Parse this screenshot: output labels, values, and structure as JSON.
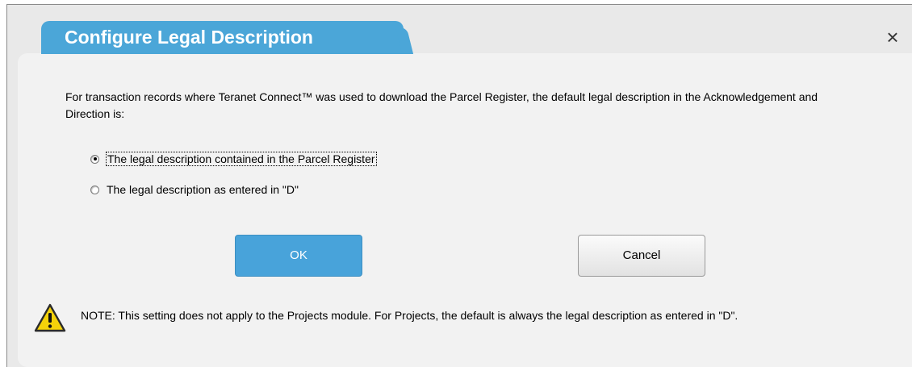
{
  "dialog": {
    "title": "Configure Legal Description",
    "close_icon": "×",
    "description": "For transaction records where Teranet Connect™ was used to download the Parcel Register, the default legal description in the Acknowledgement and Direction is:",
    "options": [
      {
        "label": "The legal description contained in the Parcel Register",
        "selected": true
      },
      {
        "label": "The legal description as entered in \"D\"",
        "selected": false
      }
    ],
    "buttons": {
      "ok_label": "OK",
      "cancel_label": "Cancel"
    },
    "note": "NOTE:  This setting does not apply to the Projects module.  For Projects, the default is always the legal description as entered in \"D\"."
  },
  "colors": {
    "accent": "#4ba6d8",
    "ok_button": "#48a3da",
    "warning_icon": "#f4d20a"
  },
  "icons": {
    "close": "close-icon",
    "warning": "warning-icon"
  }
}
